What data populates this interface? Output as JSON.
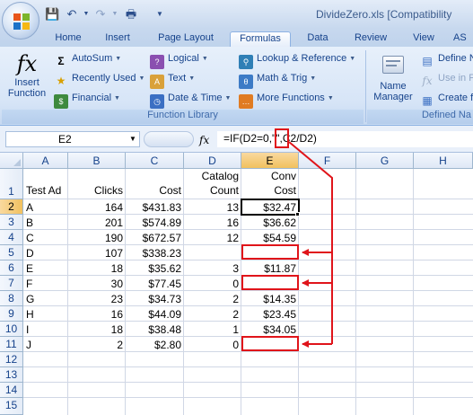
{
  "window": {
    "title": "DivideZero.xls  [Compatibility"
  },
  "quick_access": {
    "save_icon": "save-icon",
    "undo_icon": "undo-icon",
    "redo_icon": "redo-icon",
    "print_preview_icon": "print-preview-icon",
    "customize_icon": "customize-qat-icon"
  },
  "tabs": [
    "Home",
    "Insert",
    "Page Layout",
    "Formulas",
    "Data",
    "Review",
    "View",
    "AS"
  ],
  "active_tab": "Formulas",
  "ribbon": {
    "insert_function": {
      "line1": "Insert",
      "line2": "Function",
      "icon": "fx"
    },
    "autosum": "AutoSum",
    "recently_used": "Recently Used",
    "financial": "Financial",
    "logical": "Logical",
    "text": "Text",
    "date_time": "Date & Time",
    "lookup_reference": "Lookup & Reference",
    "math_trig": "Math & Trig",
    "more_functions": "More Functions",
    "function_library_label": "Function Library",
    "name_manager": {
      "line1": "Name",
      "line2": "Manager"
    },
    "define_name": "Define N",
    "use_in_formula": "Use in F",
    "create_from_selection": "Create fr",
    "defined_names_label": "Defined Na"
  },
  "formula_bar": {
    "name_box": "E2",
    "fx": "fx",
    "formula": "=IF(D2=0,\"\",C2/D2)"
  },
  "sheet": {
    "columns": [
      "A",
      "B",
      "C",
      "D",
      "E",
      "F",
      "G",
      "H"
    ],
    "rows": [
      "1",
      "2",
      "3",
      "4",
      "5",
      "6",
      "7",
      "8",
      "9",
      "10",
      "11",
      "12",
      "13",
      "14",
      "15"
    ],
    "headers": {
      "a": "Test Ad",
      "b": "Clicks",
      "c": "Cost",
      "d_line1": "Catalog",
      "d_line2": "Count",
      "e_line1": "Conv",
      "e_line2": "Cost"
    },
    "data": [
      {
        "a": "A",
        "b": "164",
        "c": "$431.83",
        "d": "13",
        "e": "$32.47"
      },
      {
        "a": "B",
        "b": "201",
        "c": "$574.89",
        "d": "16",
        "e": "$36.62"
      },
      {
        "a": "C",
        "b": "190",
        "c": "$672.57",
        "d": "12",
        "e": "$54.59"
      },
      {
        "a": "D",
        "b": "107",
        "c": "$338.23",
        "d": "",
        "e": ""
      },
      {
        "a": "E",
        "b": "18",
        "c": "$35.62",
        "d": "3",
        "e": "$11.87"
      },
      {
        "a": "F",
        "b": "30",
        "c": "$77.45",
        "d": "0",
        "e": ""
      },
      {
        "a": "G",
        "b": "23",
        "c": "$34.73",
        "d": "2",
        "e": "$14.35"
      },
      {
        "a": "H",
        "b": "16",
        "c": "$44.09",
        "d": "2",
        "e": "$23.45"
      },
      {
        "a": "I",
        "b": "18",
        "c": "$38.48",
        "d": "1",
        "e": "$34.05"
      },
      {
        "a": "J",
        "b": "2",
        "c": "$2.80",
        "d": "0",
        "e": ""
      }
    ],
    "active_cell": "E2"
  },
  "annotation": {
    "color": "#e0141a",
    "highlighted_rows": [
      "5",
      "7",
      "11"
    ]
  }
}
